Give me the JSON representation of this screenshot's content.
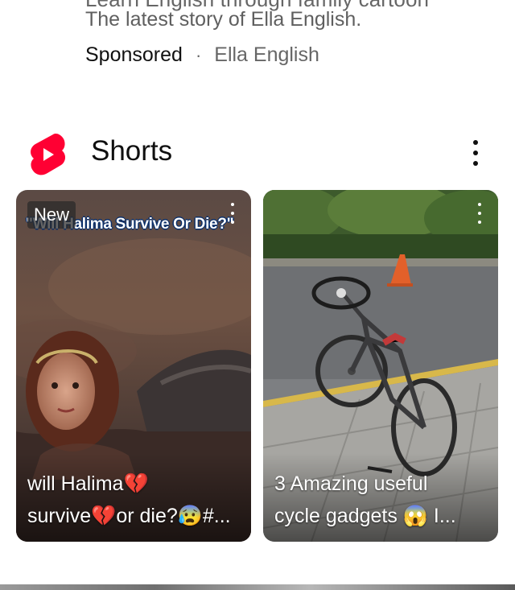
{
  "ad": {
    "cut_line": "Learn English through family cartoon",
    "description": "The latest story of Ella English.",
    "sponsored_label": "Sponsored",
    "separator": "·",
    "advertiser": "Ella English"
  },
  "shorts_section": {
    "title": "Shorts",
    "logo_icon": "youtube-shorts-logo-icon",
    "menu_icon": "more-vert-icon",
    "items": [
      {
        "badge": "New",
        "overlay_text": "\"Will Halima Survive Or Die?\"",
        "title_line1": "will Halima💔",
        "title_line2": "survive💔or die?😰#..."
      },
      {
        "badge": "",
        "overlay_text": "",
        "title_line1": "3 Amazing useful",
        "title_line2": "cycle gadgets 😱 I..."
      }
    ]
  },
  "colors": {
    "shorts_red": "#ff0033",
    "text_primary": "#0f0f0f",
    "text_secondary": "#606060"
  }
}
